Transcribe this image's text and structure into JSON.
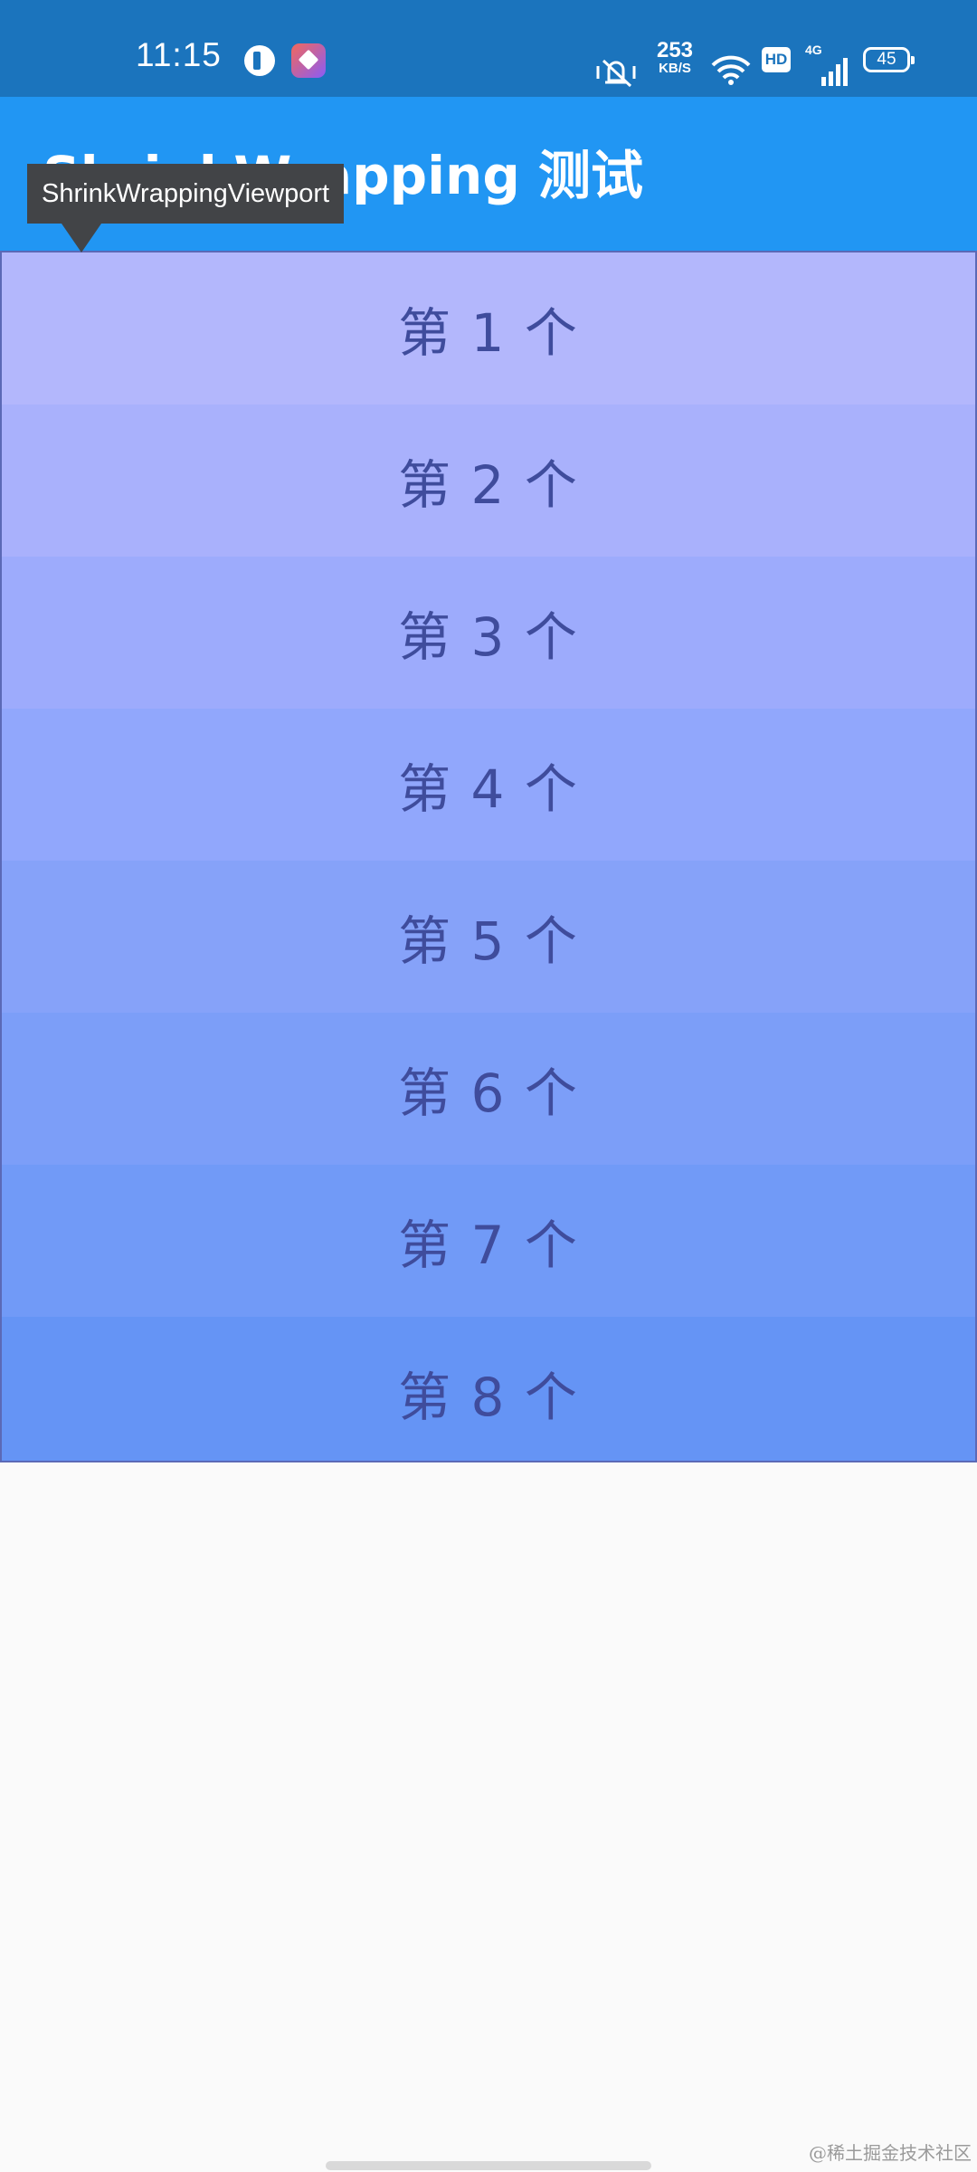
{
  "status_bar": {
    "time": "11:15",
    "speed_value": "253",
    "speed_unit": "KB/S",
    "hd_label": "HD",
    "network_type": "4G",
    "battery": "45"
  },
  "app_bar": {
    "title": "ShrinkWrapping 测试"
  },
  "tooltip": {
    "text": "ShrinkWrappingViewport"
  },
  "list": {
    "items": [
      {
        "label": "第 1 个",
        "color": "#b3b7fc"
      },
      {
        "label": "第 2 个",
        "color": "#a9b1fc"
      },
      {
        "label": "第 3 个",
        "color": "#9dabfc"
      },
      {
        "label": "第 4 个",
        "color": "#91a7fc"
      },
      {
        "label": "第 5 个",
        "color": "#86a2f9"
      },
      {
        "label": "第 6 个",
        "color": "#7c9ef8"
      },
      {
        "label": "第 7 个",
        "color": "#719af7"
      },
      {
        "label": "第 8 个",
        "color": "#6594f5"
      }
    ]
  },
  "watermark": "@稀土掘金技术社区",
  "colors": {
    "status_bar": "#1b74bd",
    "app_bar": "#2196f3",
    "tooltip_bg": "#424447",
    "item_text": "#3f4c9c",
    "viewport_border": "#5b69b6",
    "page_bg": "#fafafa"
  }
}
